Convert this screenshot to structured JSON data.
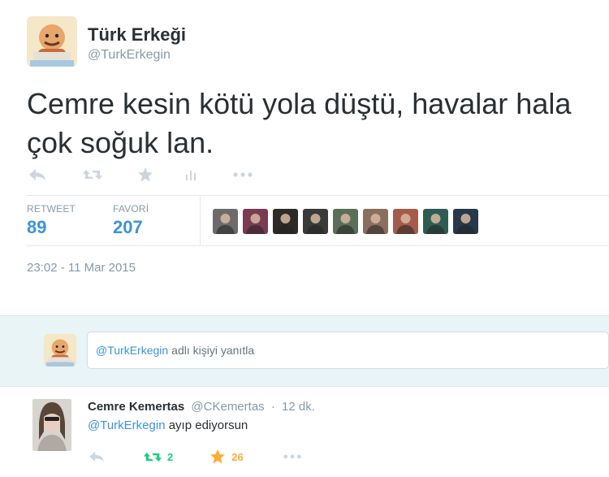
{
  "tweet": {
    "author_name": "Türk Erkeği",
    "author_handle": "@TurkErkegin",
    "text": "Cemre kesin kötü yola düştü, havalar hala çok soğuk lan.",
    "actions": [
      "reply-icon",
      "retweet-icon",
      "favorite-icon",
      "stats-icon",
      "more-icon"
    ],
    "stats": {
      "retweet_label": "RETWEET",
      "retweet_count": "89",
      "favorite_label": "FAVORİ",
      "favorite_count": "207"
    },
    "favorers": [
      {
        "color": "#6b6b6b"
      },
      {
        "color": "#7a3b54"
      },
      {
        "color": "#2d2a28"
      },
      {
        "color": "#3a3a3a"
      },
      {
        "color": "#5a6e5a"
      },
      {
        "color": "#8a6f5e"
      },
      {
        "color": "#a35c4c"
      },
      {
        "color": "#2f5c52"
      },
      {
        "color": "#26384a"
      }
    ],
    "timestamp": "23:02 - 11 Mar 2015"
  },
  "reply_box": {
    "mention": "@TurkErkegin",
    "placeholder_rest": "adlı kişiyi yanıtla"
  },
  "reply": {
    "name": "Cemre Kemertas",
    "handle": "@CKemertas",
    "separator": "·",
    "time": "12 dk.",
    "mention": "@TurkErkegin",
    "text": "ayıp ediyorsun",
    "retweet_count": "2",
    "favorite_count": "26"
  },
  "colors": {
    "link": "#3b94d9",
    "muted": "#8899a6",
    "retweet_active": "#19cf86",
    "favorite_active": "#ffac33",
    "reply_bg": "#e8f4f6"
  }
}
